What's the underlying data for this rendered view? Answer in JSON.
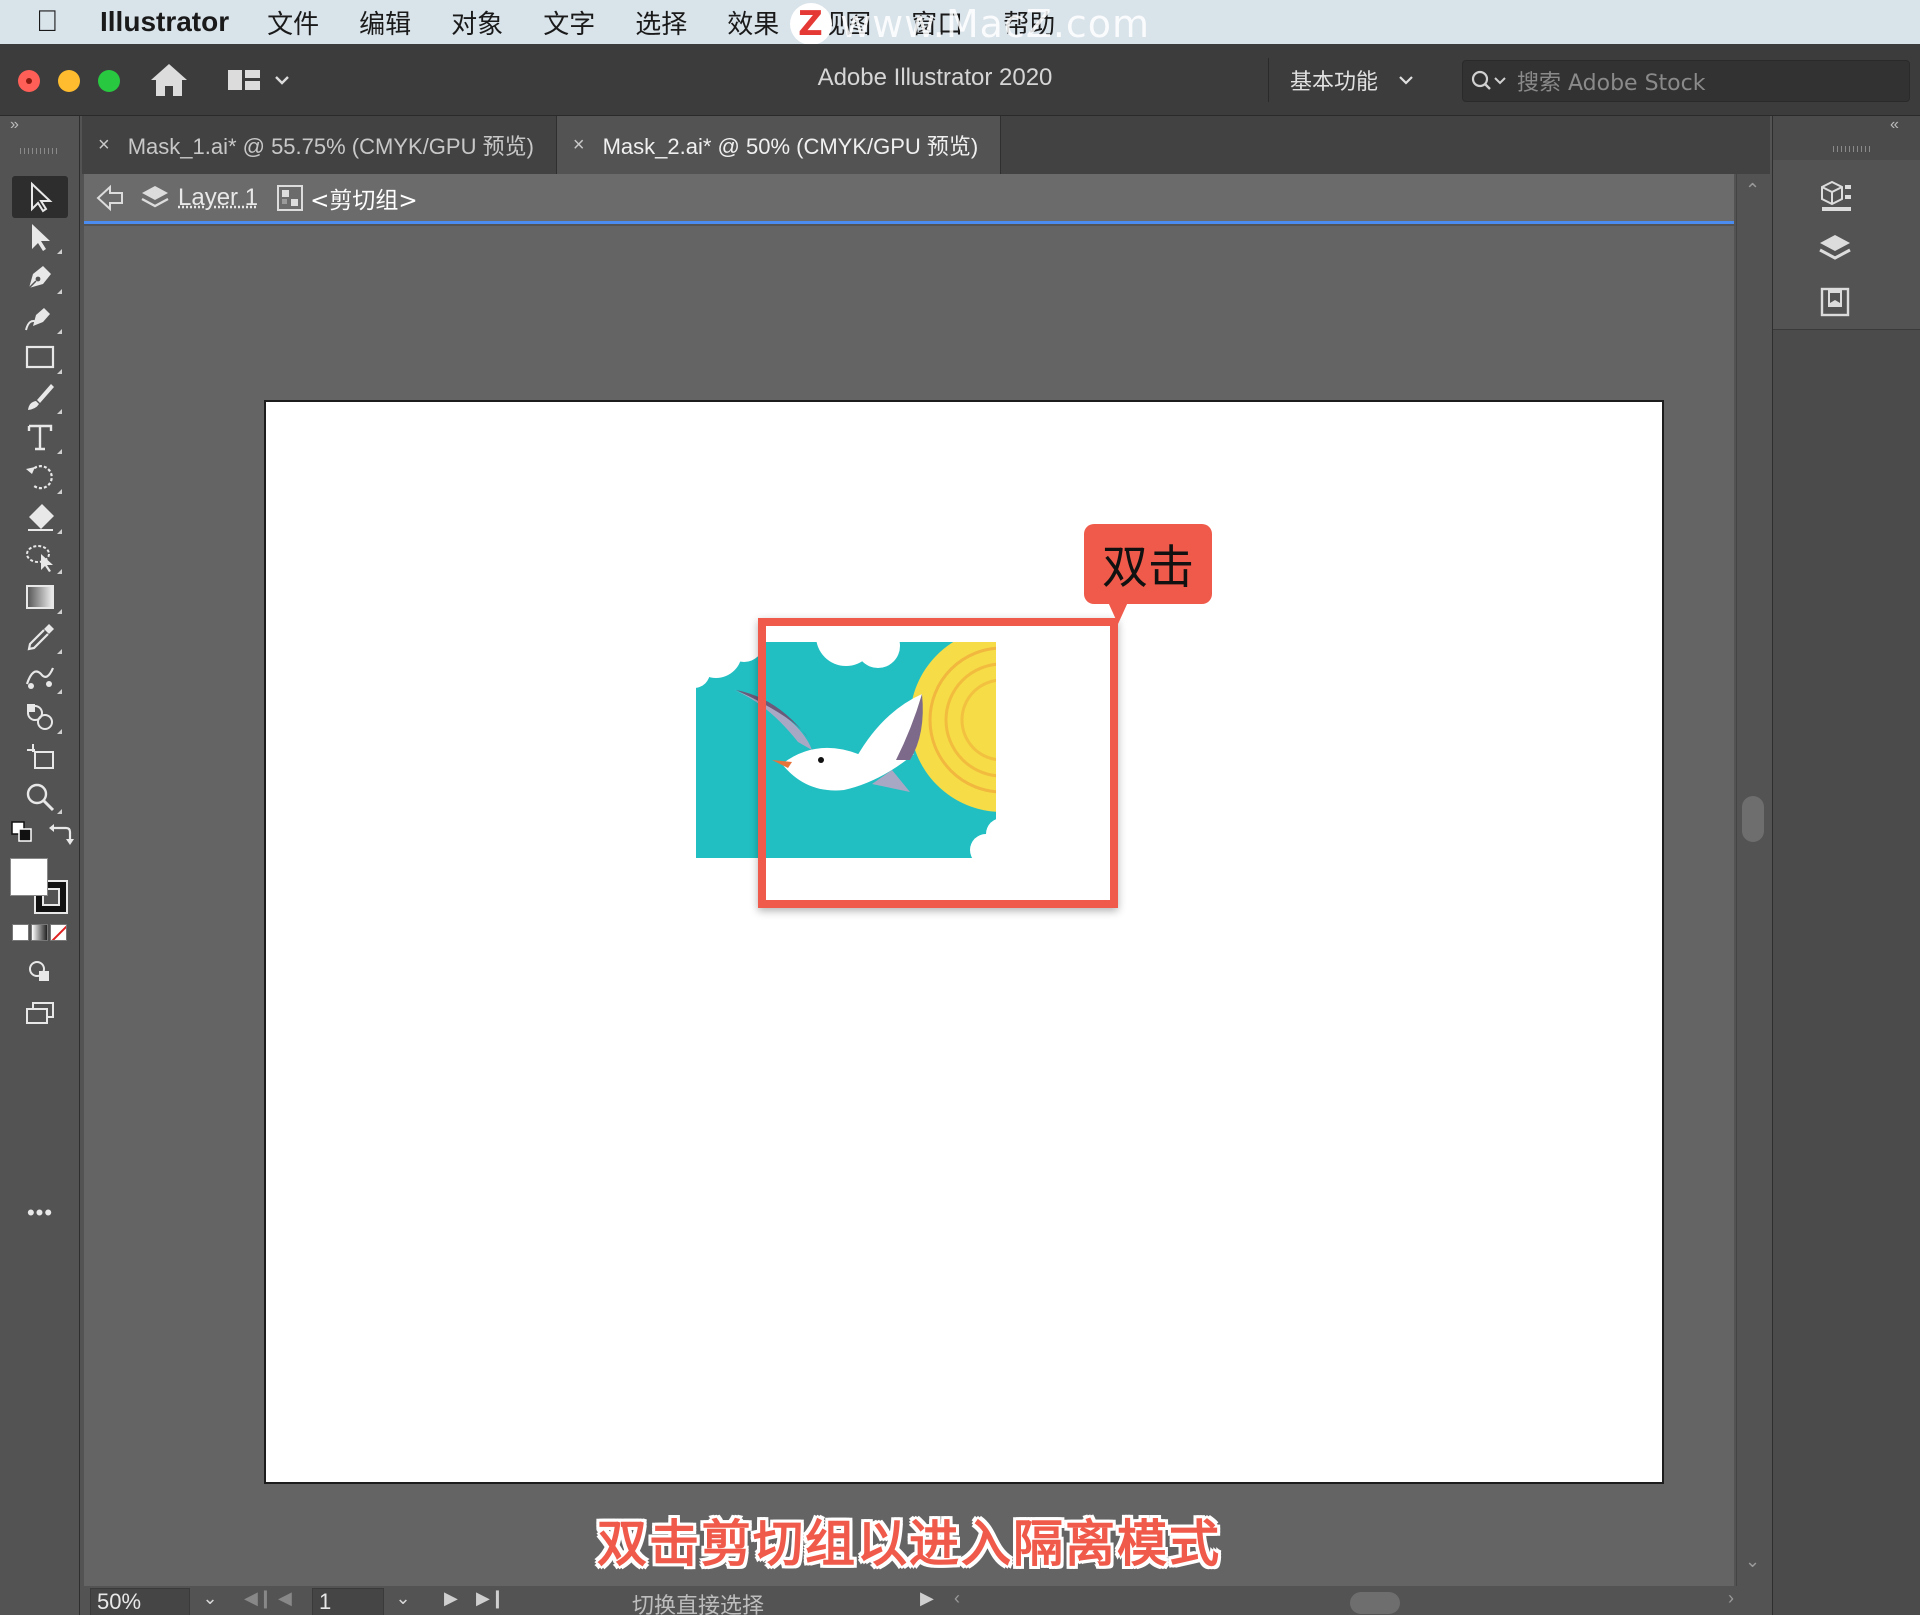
{
  "menubar": {
    "app_name": "Illustrator",
    "items": [
      "文件",
      "编辑",
      "对象",
      "文字",
      "选择",
      "效果",
      "视图",
      "窗口",
      "帮助"
    ],
    "watermark": "www.MacZ.com",
    "watermark_logo": "Z"
  },
  "titlebar": {
    "title": "Adobe Illustrator 2020",
    "workspace": "基本功能",
    "search_placeholder": "搜索 Adobe Stock"
  },
  "tabs": [
    {
      "label": "Mask_1.ai* @ 55.75% (CMYK/GPU 预览)",
      "active": false
    },
    {
      "label": "Mask_2.ai* @ 50% (CMYK/GPU 预览)",
      "active": true
    }
  ],
  "isolation_bar": {
    "layer": "Layer 1",
    "group": "<剪切组>"
  },
  "canvas": {
    "callout": "双击",
    "caption": "双击剪切组以进入隔离模式",
    "highlight_color": "#f05a4a",
    "artwork_colors": {
      "sky": "#21bfc2",
      "sun": "#f6dc47",
      "sun_ring": "#f0a63a",
      "bird": "#ffffff",
      "wing_shadow": "#a8a8c4",
      "beak": "#e8743b"
    }
  },
  "toolbar": {
    "tools": [
      "selection-tool",
      "direct-selection-tool",
      "pen-tool",
      "curvature-tool",
      "rectangle-tool",
      "paintbrush-tool",
      "type-tool",
      "rotate-tool",
      "eraser-tool",
      "lasso-tool",
      "gradient-tool",
      "eyedropper-tool",
      "puppet-warp-tool",
      "shape-builder-tool",
      "artboard-tool",
      "zoom-tool"
    ],
    "more_label": "•••"
  },
  "statusbar": {
    "zoom": "50%",
    "page": "1",
    "status_text": "切换直接选择"
  },
  "icons": {
    "collapse_left": "»",
    "collapse_right": "«",
    "close_tab": "×",
    "chevron": "⌄"
  }
}
